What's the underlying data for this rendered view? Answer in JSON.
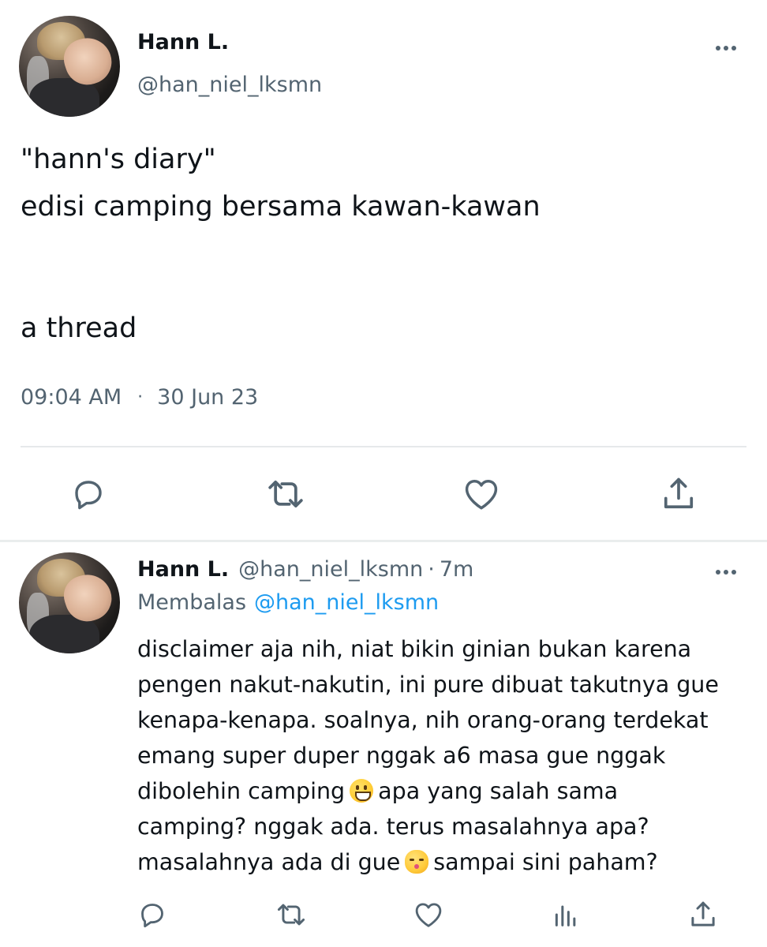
{
  "main_tweet": {
    "author_name": "Hann L.",
    "author_handle": "@han_niel_lksmn",
    "avatar_icon": "profile-photo-avatar",
    "more_icon": "more-options-icon",
    "text_lines": [
      "\"hann's diary\"",
      "edisi camping bersama kawan-kawan",
      "a thread"
    ],
    "time": "09:04 AM",
    "separator": "·",
    "date": "30 Jun 23",
    "actions": [
      "reply-icon",
      "retweet-icon",
      "like-icon",
      "share-icon"
    ]
  },
  "reply_tweet": {
    "author_name": "Hann L.",
    "author_handle": "@han_niel_lksmn",
    "dot": "·",
    "time_ago": "7m",
    "replying_label": "Membalas",
    "replying_to": "@han_niel_lksmn",
    "body_lines": [
      "disclaimer aja nih, niat bikin ginian bukan karena",
      "pengen nakut-nakutin, ini pure dibuat takutnya gue",
      "kenapa-kenapa. soalnya, nih orang-orang terdekat",
      "emang super duper nggak a6 masa gue nggak"
    ],
    "body_line5_before": "dibolehin camping",
    "body_line5_after": "apa yang salah sama",
    "body_line6": "camping? nggak ada. terus masalahnya apa?",
    "body_line7_before": "masalahnya ada di gue",
    "body_line7_after": "sampai sini paham?",
    "emojis": [
      "grinning-face-emoji",
      "kissing-cat-emoji"
    ],
    "actions": [
      "reply-icon",
      "retweet-icon",
      "like-icon",
      "views-icon",
      "share-icon"
    ]
  },
  "colors": {
    "text": "#0f1419",
    "secondary": "#536471",
    "accent": "#1d9bf0",
    "divider": "#e6e9eb"
  }
}
